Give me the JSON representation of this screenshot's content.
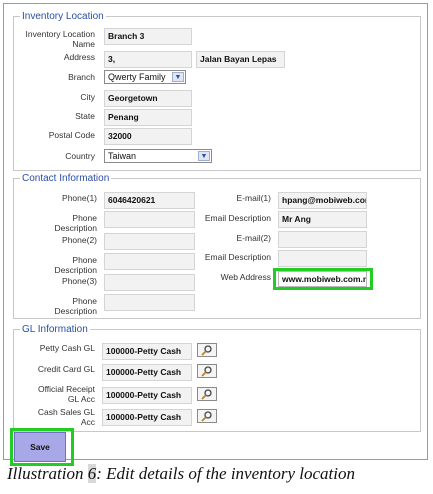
{
  "inventory_location": {
    "legend": "Inventory Location",
    "name_label": "Inventory Location Name",
    "name_value": "Branch 3",
    "address_label": "Address",
    "address_value_1": "3,",
    "address_value_2": "Jalan Bayan Lepas",
    "branch_label": "Branch",
    "branch_value": "Qwerty Family",
    "city_label": "City",
    "city_value": "Georgetown",
    "state_label": "State",
    "state_value": "Penang",
    "postal_label": "Postal Code",
    "postal_value": "32000",
    "country_label": "Country",
    "country_value": "Taiwan"
  },
  "contact": {
    "legend": "Contact Information",
    "phone1_label": "Phone(1)",
    "phone1_value": "6046420621",
    "phone_desc1_label": "Phone Description",
    "phone_desc1_value": "",
    "phone2_label": "Phone(2)",
    "phone2_value": "",
    "phone_desc2_label": "Phone Description",
    "phone_desc2_value": "",
    "phone3_label": "Phone(3)",
    "phone3_value": "",
    "phone_desc3_label": "Phone Description",
    "phone_desc3_value": "",
    "email1_label": "E-mail(1)",
    "email1_value": "hpang@mobiweb.com",
    "email_desc1_label": "Email Description",
    "email_desc1_value": "Mr Ang",
    "email2_label": "E-mail(2)",
    "email2_value": "",
    "email_desc2_label": "Email Description",
    "email_desc2_value": "",
    "web_label": "Web Address",
    "web_value": "www.mobiweb.com.my"
  },
  "gl": {
    "legend": "GL Information",
    "petty_label": "Petty Cash GL",
    "petty_value": "100000-Petty Cash",
    "credit_label": "Credit Card GL",
    "credit_value": "100000-Petty Cash",
    "receipt_label": "Official Receipt GL Acc",
    "receipt_value": "100000-Petty Cash",
    "sales_label": "Cash Sales GL Acc",
    "sales_value": "100000-Petty Cash"
  },
  "save_label": "Save",
  "caption": {
    "prefix": "Illustration ",
    "number": "6",
    "text": ": Edit details of the inventory location"
  },
  "colors": {
    "legend": "#2a4fa8",
    "highlight": "#22cc22",
    "save_button": "#a8a8e8"
  }
}
